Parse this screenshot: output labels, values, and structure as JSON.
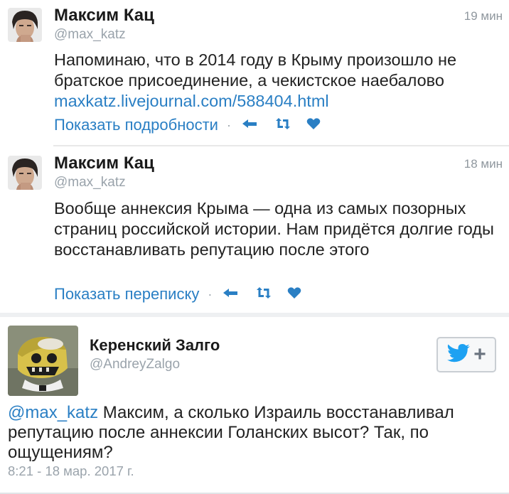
{
  "tweets": [
    {
      "name": "Максим Кац",
      "handle": "@max_katz",
      "time": "19 мин",
      "text": "Напоминаю, что в 2014 году в Крыму произошло не братское присоединение, а чекистское наебалово ",
      "link": "maxkatz.livejournal.com/588404.html",
      "action_label": "Показать подробности"
    },
    {
      "name": "Максим Кац",
      "handle": "@max_katz",
      "time": "18 мин",
      "text": "Вообще аннексия Крыма — одна из самых позорных страниц российской истории. Нам придётся долгие годы восстанавливать репутацию после этого",
      "action_label": "Показать переписку"
    }
  ],
  "embed": {
    "name": "Керенский Залго",
    "handle": "@AndreyZalgo",
    "mention": "@max_katz",
    "text": " Максим, а сколько Израиль восстанавливал репутацию после аннексии Голанских высот? Так, по ощущениям?",
    "date": "8:21 - 18 мар. 2017 г.",
    "follow_plus": "+"
  },
  "icons": {
    "reply": "reply-icon",
    "retweet": "retweet-icon",
    "like": "heart-icon",
    "follow": "twitter-bird-icon"
  },
  "colors": {
    "link": "#2a7fc4",
    "muted": "#9aa3ab",
    "bird": "#1da1f2"
  }
}
